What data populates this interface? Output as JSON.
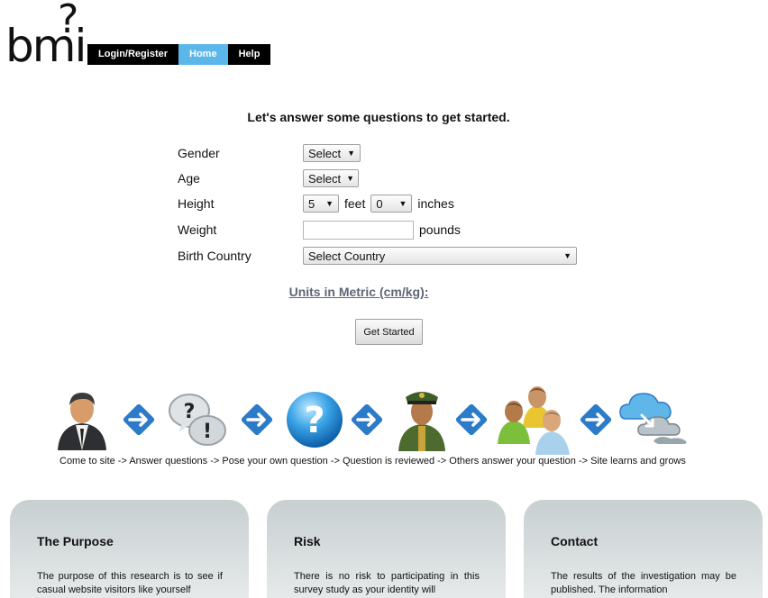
{
  "logo": {
    "text": "bmi",
    "mark": "?"
  },
  "nav": [
    {
      "label": "Login/Register",
      "active": false
    },
    {
      "label": "Home",
      "active": true
    },
    {
      "label": "Help",
      "active": false
    }
  ],
  "form": {
    "intro": "Let's answer some questions to get started.",
    "gender": {
      "label": "Gender",
      "value": "Select"
    },
    "age": {
      "label": "Age",
      "value": "Select"
    },
    "height": {
      "label": "Height",
      "feet_value": "5",
      "feet_unit": "feet",
      "inches_value": "0",
      "inches_unit": "inches"
    },
    "weight": {
      "label": "Weight",
      "value": "",
      "unit": "pounds"
    },
    "country": {
      "label": "Birth Country",
      "value": "Select Country"
    },
    "metric_link": "Units in Metric (cm/kg):",
    "submit": "Get Started"
  },
  "process": {
    "icons": [
      "person-icon",
      "arrow-right-icon",
      "question-bubbles-icon",
      "arrow-right-icon",
      "question-orb-icon",
      "arrow-right-icon",
      "officer-icon",
      "arrow-right-icon",
      "group-icon",
      "arrow-right-icon",
      "cloud-sync-icon"
    ],
    "caption": "Come to site -> Answer questions -> Pose your own question -> Question is reviewed -> Others answer your question -> Site learns and grows"
  },
  "cards": [
    {
      "title": "The Purpose",
      "text": "The purpose of this research is to see if casual website visitors like yourself"
    },
    {
      "title": "Risk",
      "text": "There is no risk to participating in this survey study as your identity will"
    },
    {
      "title": "Contact",
      "text": "The results of the investigation may be published. The information"
    }
  ],
  "colors": {
    "nav_bg": "#000000",
    "nav_active": "#5bb7ea",
    "link": "#5e6677",
    "arrow_blue": "#2c7bc8",
    "card_bg": "#d3d9da"
  }
}
